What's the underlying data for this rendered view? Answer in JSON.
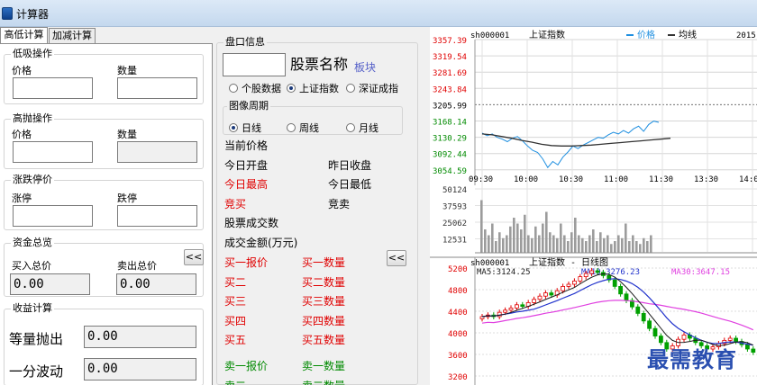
{
  "window": {
    "title": "计算器"
  },
  "tabs": [
    {
      "label": "高低计算"
    },
    {
      "label": "加减计算"
    }
  ],
  "left": {
    "low_group": {
      "title": "低吸操作",
      "price_label": "价格",
      "qty_label": "数量",
      "price_value": "",
      "qty_value": ""
    },
    "high_group": {
      "title": "高抛操作",
      "price_label": "价格",
      "qty_label": "数量",
      "price_value": "",
      "qty_value": ""
    },
    "limit_group": {
      "title": "涨跌停价",
      "up_label": "涨停",
      "down_label": "跌停",
      "up_value": "",
      "down_value": ""
    },
    "total_group": {
      "title": "资金总览",
      "buy_label": "买入总价",
      "sell_label": "卖出总价",
      "buy_value": "0.00",
      "sell_value": "0.00",
      "arrow_button": "<<"
    },
    "profit_group": {
      "title": "收益计算",
      "equal_label": "等量抛出",
      "equal_value": "0.00",
      "tick_label": "一分波动",
      "tick_value": "0.00"
    }
  },
  "middle": {
    "title": "盘口信息",
    "stock_code_value": "",
    "stock_name_label": "股票名称",
    "sector_label": "板块",
    "index_radios": [
      {
        "label": "个股数据",
        "checked": false
      },
      {
        "label": "上证指数",
        "checked": true
      },
      {
        "label": "深证成指",
        "checked": false
      }
    ],
    "period_title": "图像周期",
    "period_radios": [
      {
        "label": "日线",
        "checked": true
      },
      {
        "label": "周线",
        "checked": false
      },
      {
        "label": "月线",
        "checked": false
      }
    ],
    "fields": {
      "current_price": "当前价格",
      "today_open": "今日开盘",
      "yesterday_close": "昨日收盘",
      "today_high": "今日最高",
      "today_low": "今日最低",
      "bid": "竞买",
      "ask": "竞卖",
      "volume": "股票成交数",
      "amount": "成交金额(万元)"
    },
    "arrow_button": "<<",
    "buy_rows": [
      {
        "price": "买一报价",
        "qty": "买一数量"
      },
      {
        "price": "买二",
        "qty": "买二数量"
      },
      {
        "price": "买三",
        "qty": "买三数量"
      },
      {
        "price": "买四",
        "qty": "买四数量"
      },
      {
        "price": "买五",
        "qty": "买五数量"
      }
    ],
    "sell_rows": [
      {
        "price": "卖一报价",
        "qty": "卖一数量"
      },
      {
        "price": "卖二",
        "qty": "卖二数量"
      }
    ]
  },
  "chart": {
    "intraday": {
      "code": "sh000001",
      "name": "上证指数",
      "legend_price": "价格",
      "legend_avg": "均线",
      "corner": "2015",
      "price_ticks": [
        "3357.39",
        "3319.54",
        "3281.69",
        "3243.84",
        "3205.99",
        "3168.14",
        "3130.29",
        "3092.44",
        "3054.59"
      ],
      "time_ticks": [
        "09:30",
        "10:00",
        "10:30",
        "11:00",
        "11:30",
        "13:30",
        "14:00"
      ],
      "volume_ticks": [
        "50124",
        "37593",
        "25062",
        "12531"
      ],
      "price_color": "#1f8fe0",
      "avg_color": "#333333",
      "ref_price": 3205.99
    },
    "daily": {
      "code": "sh000001",
      "name": "上证指数 - 日线图",
      "ma5_label": "MA5:3124.25",
      "ma10_label": "MA10:3276.23",
      "ma30_label": "MA30:3647.15",
      "ma5_color": "#1a1a1a",
      "ma10_color": "#2233cc",
      "ma30_color": "#e040e0",
      "price_ticks": [
        "5200",
        "4800",
        "4400",
        "4000",
        "3600",
        "3200"
      ],
      "up_color": "#e00000",
      "down_color": "#00a000"
    }
  },
  "watermark": "最需教育"
}
